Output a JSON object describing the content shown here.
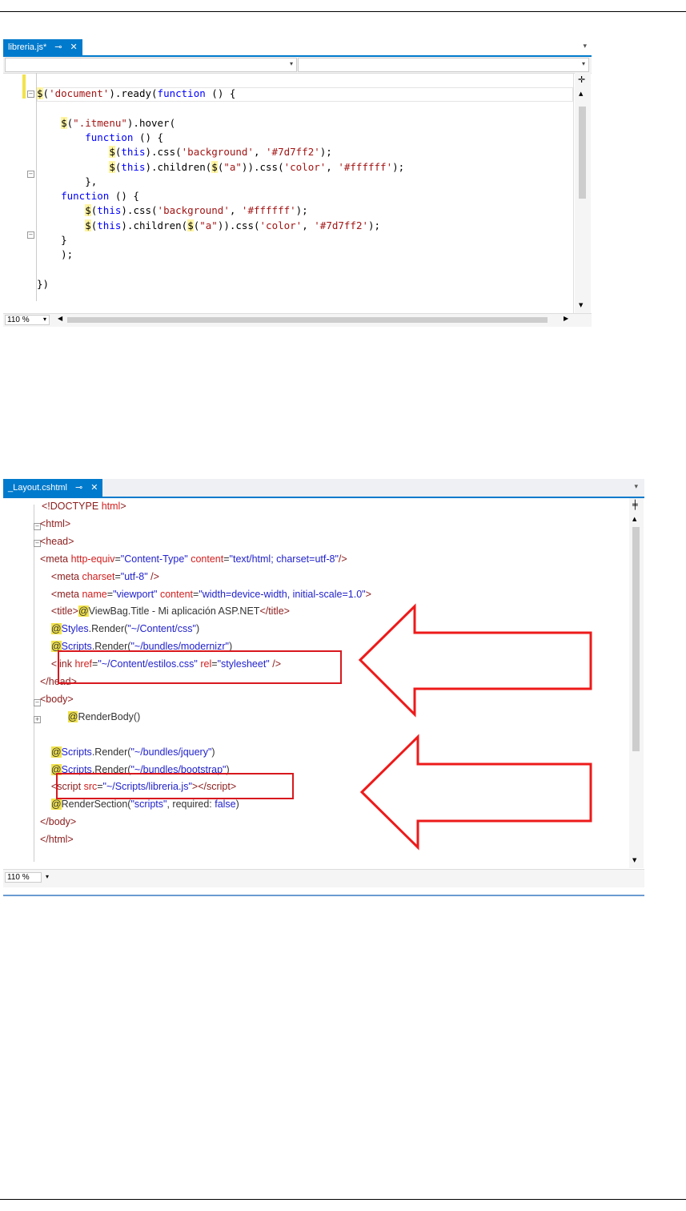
{
  "editor1": {
    "tab_label": "libreria.js*",
    "pin_glyph": "⊸",
    "close_glyph": "✕",
    "overflow_glyph": "▾",
    "split_glyph": "✛",
    "zoom": "110 %",
    "lines": [
      {
        "html": "<span class=\"d\">$</span>(<span class=\"s\">'document'</span>).ready(<span class=\"k\">function</span> () {"
      },
      {
        "html": ""
      },
      {
        "html": "    <span class=\"d\">$</span>(<span class=\"s\">\".itmenu\"</span>).hover("
      },
      {
        "html": "        <span class=\"k\">function</span> () {"
      },
      {
        "html": "            <span class=\"d\">$</span>(<span class=\"k\">this</span>).css(<span class=\"s\">'background'</span>, <span class=\"s\">'#7d7ff2'</span>);"
      },
      {
        "html": "            <span class=\"d\">$</span>(<span class=\"k\">this</span>).children(<span class=\"d\">$</span>(<span class=\"s\">\"a\"</span>)).css(<span class=\"s\">'color'</span>, <span class=\"s\">'#ffffff'</span>);"
      },
      {
        "html": "        },"
      },
      {
        "html": "    <span class=\"k\">function</span> () {"
      },
      {
        "html": "        <span class=\"d\">$</span>(<span class=\"k\">this</span>).css(<span class=\"s\">'background'</span>, <span class=\"s\">'#ffffff'</span>);"
      },
      {
        "html": "        <span class=\"d\">$</span>(<span class=\"k\">this</span>).children(<span class=\"d\">$</span>(<span class=\"s\">\"a\"</span>)).css(<span class=\"s\">'color'</span>, <span class=\"s\">'#7d7ff2'</span>);"
      },
      {
        "html": "    }"
      },
      {
        "html": "    );"
      },
      {
        "html": ""
      },
      {
        "html": "})"
      }
    ]
  },
  "editor2": {
    "tab_label": "_Layout.cshtml",
    "pin_glyph": "⊸",
    "close_glyph": "✕",
    "overflow_glyph": "▾",
    "split_glyph": "╪",
    "zoom": "110 %",
    "lines": [
      {
        "html": "<span class=\"tg\">&lt;!DOCTYPE</span> <span class=\"at\">html</span><span class=\"tg\">&gt;</span>"
      },
      {
        "html": "<span class=\"tg\">&lt;html&gt;</span>"
      },
      {
        "html": "<span class=\"tg\">&lt;head&gt;</span>"
      },
      {
        "html": "<span class=\"tg\">&lt;meta</span> <span class=\"at\">http-equiv</span>=<span class=\"av\">\"Content-Type\"</span> <span class=\"at\">content</span>=<span class=\"av\">\"text/html; charset=utf-8\"</span><span class=\"tg\">/&gt;</span>"
      },
      {
        "html": "    <span class=\"tg\">&lt;meta</span> <span class=\"at\">charset</span>=<span class=\"av\">\"utf-8\"</span> <span class=\"tg\">/&gt;</span>"
      },
      {
        "html": "    <span class=\"tg\">&lt;meta</span> <span class=\"at\">name</span>=<span class=\"av\">\"viewport\"</span> <span class=\"at\">content</span>=<span class=\"av\">\"width=device-width, initial-scale=1.0\"</span><span class=\"tg\">&gt;</span>"
      },
      {
        "html": "    <span class=\"tg\">&lt;title&gt;</span><span class=\"ra\">@</span>ViewBag.Title - Mi aplicación ASP.NET<span class=\"tg\">&lt;/title&gt;</span>"
      },
      {
        "html": "    <span class=\"ra\">@</span><span class=\"av\">Styles</span>.Render(<span class=\"av\">\"~/Content/css\"</span>)"
      },
      {
        "html": "    <span class=\"ra\">@</span><span class=\"av\">Scripts</span>.Render(<span class=\"av\">\"~/bundles/modernizr\"</span>)"
      },
      {
        "html": "    <span class=\"tg\">&lt;link</span> <span class=\"at\">href</span>=<span class=\"av\">\"~/Content/estilos.css\"</span> <span class=\"at\">rel</span>=<span class=\"av\">\"stylesheet\"</span> <span class=\"tg\">/&gt;</span>"
      },
      {
        "html": "<span class=\"tg\">&lt;/head&gt;</span>"
      },
      {
        "html": "<span class=\"tg\">&lt;body&gt;</span>"
      },
      {
        "html": "          <span class=\"ra\">@</span>RenderBody()"
      },
      {
        "html": ""
      },
      {
        "html": "    <span class=\"ra\">@</span><span class=\"av\">Scripts</span>.Render(<span class=\"av\">\"~/bundles/jquery\"</span>)"
      },
      {
        "html": "    <span class=\"ra\">@</span><span class=\"av\">Scripts</span>.Render(<span class=\"av\">\"~/bundles/bootstrap\"</span>)"
      },
      {
        "html": "    <span class=\"tg\">&lt;script</span> <span class=\"at\">src</span>=<span class=\"av\">\"~/Scripts/libreria.js\"</span><span class=\"tg\">&gt;&lt;/script&gt;</span>"
      },
      {
        "html": "    <span class=\"ra\">@</span>RenderSection(<span class=\"av\">\"scripts\"</span>, required: <span class=\"av\">false</span>)"
      },
      {
        "html": "<span class=\"tg\">&lt;/body&gt;</span>"
      },
      {
        "html": "<span class=\"tg\">&lt;/html&gt;</span>"
      }
    ]
  }
}
